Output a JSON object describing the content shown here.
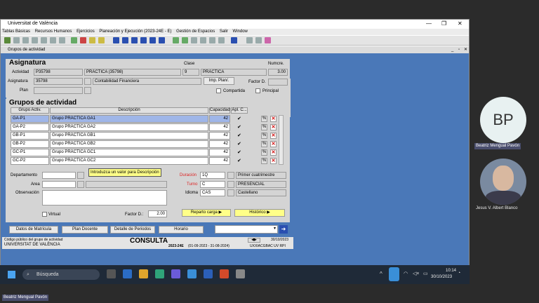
{
  "window": {
    "title": "Universitat de València"
  },
  "menu": [
    "Tablas Básicas",
    "Recursos Humanos",
    "Ejercicios",
    "Planeación y Ejecución (2023-24E - E)",
    "Gestión de Espacios",
    "Salir",
    "Window"
  ],
  "form": {
    "title": "Grupos de actividad",
    "asignatura": {
      "heading": "Asignatura",
      "clase_label": "Clase",
      "numcre_label": "Numcre.",
      "actividad_label": "Actividad",
      "actividad_code": "P35798",
      "actividad_name": "PRÁCTICA (35798)",
      "clase_num": "9",
      "clase_name": "PRÁCTICA",
      "numcre": "3.00",
      "asignatura_label": "Asignatura",
      "asignatura_code": "35798",
      "asignatura_name": "Contabilidad Financiera",
      "plan_button": "Imp. Plan/.",
      "factor_label": "Factor D.",
      "plan_label": "Plan",
      "compartida_label": "Compartida",
      "principal_label": "Principal"
    },
    "grupos": {
      "heading": "Grupos de actividad",
      "col_grupo": "Grupo Activ.",
      "col_desc": "Descripción",
      "col_cap": "Capacidad",
      "col_apl": "Apl. C...",
      "rows": [
        {
          "code": "GA-P1",
          "desc": "Grupo PRÁCTICA GA1",
          "cap": "42",
          "check": "✔"
        },
        {
          "code": "GA-P2",
          "desc": "Grupo PRÁCTICA GA2",
          "cap": "42",
          "check": "✔"
        },
        {
          "code": "GB-P1",
          "desc": "Grupo PRÁCTICA GB1",
          "cap": "42",
          "check": "✔"
        },
        {
          "code": "GB-P2",
          "desc": "Grupo PRÁCTICA GB2",
          "cap": "42",
          "check": "✔"
        },
        {
          "code": "GC-P1",
          "desc": "Grupo PRÁCTICA GC1",
          "cap": "42",
          "check": "✔"
        },
        {
          "code": "GC-P2",
          "desc": "Grupo PRÁCTICA GC2",
          "cap": "42",
          "check": "✔"
        }
      ]
    },
    "tooltip": "Introduzca un valor para Descripción",
    "details": {
      "departamento_label": "Departamento",
      "area_label": "Area",
      "observacion_label": "Observación",
      "duracion_label": "Duración",
      "duracion": "1Q",
      "duracion_desc": "Primer cuatrimestre",
      "turno_label": "Turno",
      "turno": "C",
      "turno_desc": "PRESENCIAL",
      "idioma_label": "Idioma",
      "idioma": "CAS",
      "idioma_desc": "Castellano",
      "virtual_label": "Virtual",
      "factor_label": "Factor D.:",
      "factor": "2.00",
      "reparto_button": "Reparto carga",
      "historico_button": "Histórico"
    },
    "bottom_buttons": [
      "Datos de Matrícula",
      "Plan Docente",
      "Detalle de Periodos",
      "Horario"
    ],
    "status": {
      "left1": "Código público del grupo de actividad",
      "left2": "UNIVERSITAT DE VALÈNCIA",
      "mode": "CONSULTA",
      "period_code": "2023-24E",
      "period": "(01-09-2023 - 31-08-2024)",
      "date": "30/10/2023",
      "user": "UXXIACGBAC  UV  RPI"
    }
  },
  "taskbar": {
    "search": "Búsqueda",
    "time": "10:14",
    "date": "30/10/2023"
  },
  "participants": [
    {
      "initials": "BP",
      "name": "Beatriz Mengual Pavón"
    },
    {
      "name": "Jesus V. Albert Blanco"
    }
  ],
  "self_label": "Beatriz Mengual Pavón",
  "colors": {
    "panel": "#d4d4d4",
    "form_bg": "#4a78b8",
    "avatar": "#e8f1f1",
    "taskbar": "#1f2a38"
  }
}
